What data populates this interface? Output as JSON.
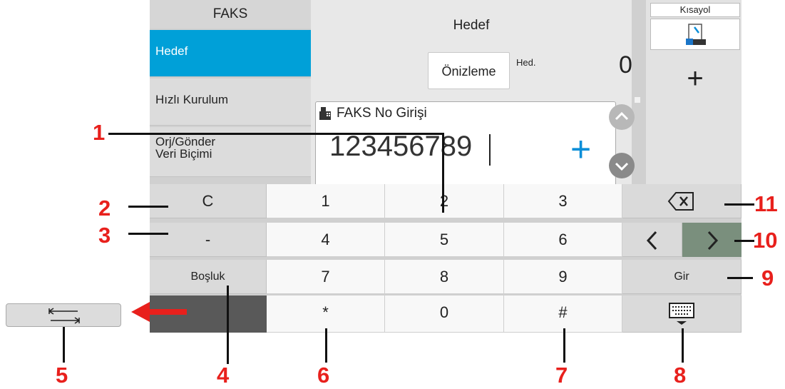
{
  "menu": {
    "title": "FAKS",
    "items": [
      {
        "label": "Hedef"
      },
      {
        "label": "Hızlı Kurulum"
      },
      {
        "label_line1": "Orj/Gönder",
        "label_line2": "Veri Biçimi"
      }
    ]
  },
  "destination": {
    "title": "Hedef",
    "preview_label": "Önizleme",
    "dest_label": "Hed.",
    "dest_count": "0"
  },
  "shortcut": {
    "label": "Kısayol",
    "add_label": "+"
  },
  "input": {
    "title": "FAKS No Girişi",
    "value": "123456789",
    "add_label": "+"
  },
  "keypad": {
    "clear": "C",
    "dash": "-",
    "space": "Boşluk",
    "keys": [
      "1",
      "2",
      "3",
      "4",
      "5",
      "6",
      "7",
      "8",
      "9",
      "*",
      "0",
      "#"
    ],
    "enter": "Gir"
  },
  "callouts": [
    "1",
    "2",
    "3",
    "4",
    "5",
    "6",
    "7",
    "8",
    "9",
    "10",
    "11"
  ],
  "colors": {
    "accent": "#00a0d8",
    "callout": "#e8201c",
    "plus": "#0a8ed8"
  },
  "icons": [
    "fax-icon",
    "backspace-icon",
    "chevron-left-icon",
    "chevron-right-icon",
    "keyboard-icon",
    "tab-icon",
    "chevron-up-icon",
    "chevron-down-icon",
    "shortcut-icon"
  ]
}
